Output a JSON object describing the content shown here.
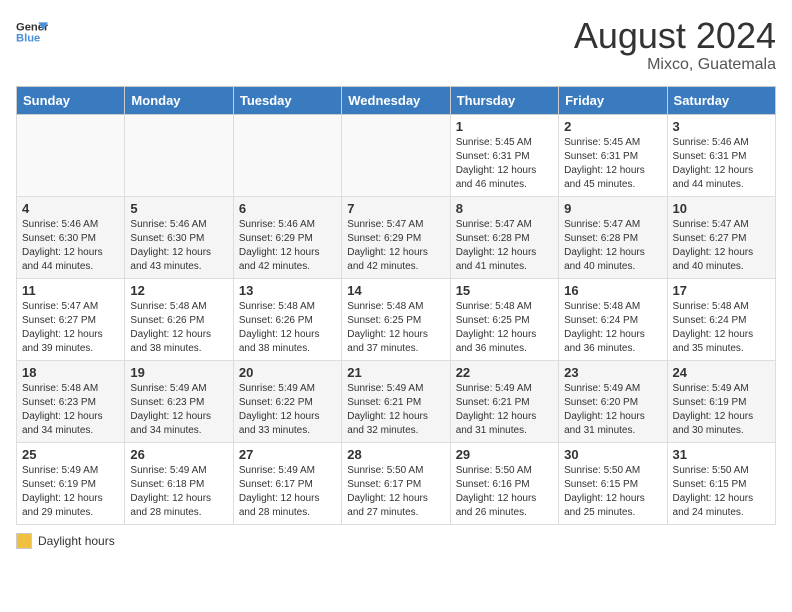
{
  "header": {
    "logo_line1": "General",
    "logo_line2": "Blue",
    "month_year": "August 2024",
    "location": "Mixco, Guatemala"
  },
  "days_of_week": [
    "Sunday",
    "Monday",
    "Tuesday",
    "Wednesday",
    "Thursday",
    "Friday",
    "Saturday"
  ],
  "legend": {
    "label": "Daylight hours"
  },
  "weeks": [
    [
      {
        "day": "",
        "detail": ""
      },
      {
        "day": "",
        "detail": ""
      },
      {
        "day": "",
        "detail": ""
      },
      {
        "day": "",
        "detail": ""
      },
      {
        "day": "1",
        "detail": "Sunrise: 5:45 AM\nSunset: 6:31 PM\nDaylight: 12 hours\nand 46 minutes."
      },
      {
        "day": "2",
        "detail": "Sunrise: 5:45 AM\nSunset: 6:31 PM\nDaylight: 12 hours\nand 45 minutes."
      },
      {
        "day": "3",
        "detail": "Sunrise: 5:46 AM\nSunset: 6:31 PM\nDaylight: 12 hours\nand 44 minutes."
      }
    ],
    [
      {
        "day": "4",
        "detail": "Sunrise: 5:46 AM\nSunset: 6:30 PM\nDaylight: 12 hours\nand 44 minutes."
      },
      {
        "day": "5",
        "detail": "Sunrise: 5:46 AM\nSunset: 6:30 PM\nDaylight: 12 hours\nand 43 minutes."
      },
      {
        "day": "6",
        "detail": "Sunrise: 5:46 AM\nSunset: 6:29 PM\nDaylight: 12 hours\nand 42 minutes."
      },
      {
        "day": "7",
        "detail": "Sunrise: 5:47 AM\nSunset: 6:29 PM\nDaylight: 12 hours\nand 42 minutes."
      },
      {
        "day": "8",
        "detail": "Sunrise: 5:47 AM\nSunset: 6:28 PM\nDaylight: 12 hours\nand 41 minutes."
      },
      {
        "day": "9",
        "detail": "Sunrise: 5:47 AM\nSunset: 6:28 PM\nDaylight: 12 hours\nand 40 minutes."
      },
      {
        "day": "10",
        "detail": "Sunrise: 5:47 AM\nSunset: 6:27 PM\nDaylight: 12 hours\nand 40 minutes."
      }
    ],
    [
      {
        "day": "11",
        "detail": "Sunrise: 5:47 AM\nSunset: 6:27 PM\nDaylight: 12 hours\nand 39 minutes."
      },
      {
        "day": "12",
        "detail": "Sunrise: 5:48 AM\nSunset: 6:26 PM\nDaylight: 12 hours\nand 38 minutes."
      },
      {
        "day": "13",
        "detail": "Sunrise: 5:48 AM\nSunset: 6:26 PM\nDaylight: 12 hours\nand 38 minutes."
      },
      {
        "day": "14",
        "detail": "Sunrise: 5:48 AM\nSunset: 6:25 PM\nDaylight: 12 hours\nand 37 minutes."
      },
      {
        "day": "15",
        "detail": "Sunrise: 5:48 AM\nSunset: 6:25 PM\nDaylight: 12 hours\nand 36 minutes."
      },
      {
        "day": "16",
        "detail": "Sunrise: 5:48 AM\nSunset: 6:24 PM\nDaylight: 12 hours\nand 36 minutes."
      },
      {
        "day": "17",
        "detail": "Sunrise: 5:48 AM\nSunset: 6:24 PM\nDaylight: 12 hours\nand 35 minutes."
      }
    ],
    [
      {
        "day": "18",
        "detail": "Sunrise: 5:48 AM\nSunset: 6:23 PM\nDaylight: 12 hours\nand 34 minutes."
      },
      {
        "day": "19",
        "detail": "Sunrise: 5:49 AM\nSunset: 6:23 PM\nDaylight: 12 hours\nand 34 minutes."
      },
      {
        "day": "20",
        "detail": "Sunrise: 5:49 AM\nSunset: 6:22 PM\nDaylight: 12 hours\nand 33 minutes."
      },
      {
        "day": "21",
        "detail": "Sunrise: 5:49 AM\nSunset: 6:21 PM\nDaylight: 12 hours\nand 32 minutes."
      },
      {
        "day": "22",
        "detail": "Sunrise: 5:49 AM\nSunset: 6:21 PM\nDaylight: 12 hours\nand 31 minutes."
      },
      {
        "day": "23",
        "detail": "Sunrise: 5:49 AM\nSunset: 6:20 PM\nDaylight: 12 hours\nand 31 minutes."
      },
      {
        "day": "24",
        "detail": "Sunrise: 5:49 AM\nSunset: 6:19 PM\nDaylight: 12 hours\nand 30 minutes."
      }
    ],
    [
      {
        "day": "25",
        "detail": "Sunrise: 5:49 AM\nSunset: 6:19 PM\nDaylight: 12 hours\nand 29 minutes."
      },
      {
        "day": "26",
        "detail": "Sunrise: 5:49 AM\nSunset: 6:18 PM\nDaylight: 12 hours\nand 28 minutes."
      },
      {
        "day": "27",
        "detail": "Sunrise: 5:49 AM\nSunset: 6:17 PM\nDaylight: 12 hours\nand 28 minutes."
      },
      {
        "day": "28",
        "detail": "Sunrise: 5:50 AM\nSunset: 6:17 PM\nDaylight: 12 hours\nand 27 minutes."
      },
      {
        "day": "29",
        "detail": "Sunrise: 5:50 AM\nSunset: 6:16 PM\nDaylight: 12 hours\nand 26 minutes."
      },
      {
        "day": "30",
        "detail": "Sunrise: 5:50 AM\nSunset: 6:15 PM\nDaylight: 12 hours\nand 25 minutes."
      },
      {
        "day": "31",
        "detail": "Sunrise: 5:50 AM\nSunset: 6:15 PM\nDaylight: 12 hours\nand 24 minutes."
      }
    ]
  ]
}
